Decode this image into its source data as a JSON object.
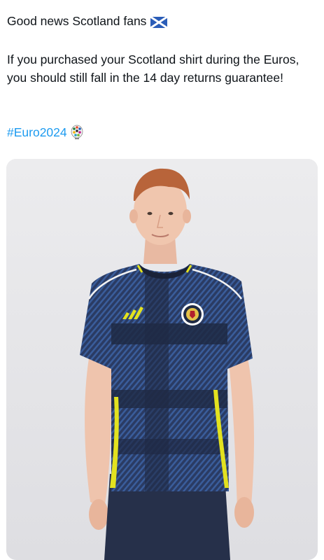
{
  "tweet": {
    "line1": "Good news Scotland fans",
    "flag_icon": "scotland-flag-icon",
    "body": "If you purchased your Scotland shirt during the Euros, you should still fall in the 14 day returns guarantee!",
    "hashtag": "#Euro2024",
    "hashtag_icon": "euro2024-logo-icon"
  },
  "media": {
    "subject": "scotland-kit-photo",
    "colors": {
      "background": "#e9e9eb",
      "shirt_navy": "#1f2a44",
      "shirt_blue": "#2f4f86",
      "accent_yellow": "#e3e21f",
      "link": "#1d9bf0"
    }
  }
}
